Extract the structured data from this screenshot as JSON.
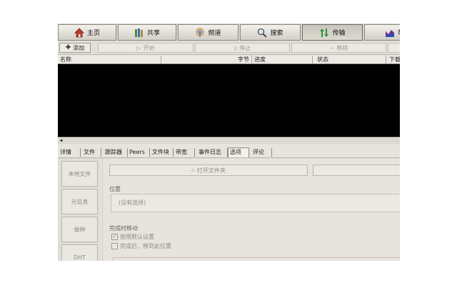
{
  "nav": {
    "home": "主页",
    "share": "共享",
    "channels": "频道",
    "search": "搜索",
    "transfers": "传输",
    "stats_partial": "带"
  },
  "toolbar": {
    "add": "添加",
    "start": "开始",
    "stop": "停止",
    "remove": "移除"
  },
  "columns": [
    "名称",
    "字节",
    "进度",
    "状态",
    "下载"
  ],
  "hscroll_arrow": "◂",
  "tabs": [
    "详情",
    "文件",
    "跟踪器",
    "Peers",
    "文件块",
    "带宽",
    "事件日志",
    "选项",
    "评论"
  ],
  "active_tab": "选项",
  "side_buttons": [
    "本地文件",
    "元信息",
    "做种",
    "DHT"
  ],
  "options": {
    "open_folder": "打开文件夹",
    "location_label": "位置",
    "location_value": "(没有选择)",
    "move_on_complete_label": "完成时移动",
    "use_default": "使用默认设置",
    "move_after_complete": "完成后，移到此位置"
  },
  "icons": {
    "home": "home-icon",
    "share": "books-icon",
    "channels": "broadcast-icon",
    "search": "magnifier-icon",
    "transfers": "updown-arrows-icon",
    "stats": "chart-icon"
  }
}
